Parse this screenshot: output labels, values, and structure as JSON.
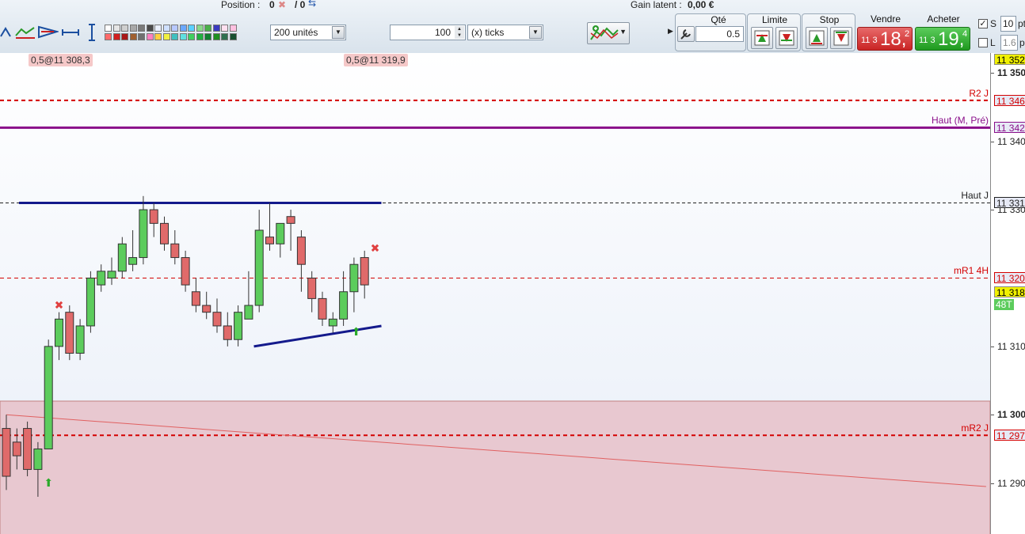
{
  "top": {
    "position_label": "Position :",
    "position_value": "0",
    "position_sep": "/ 0",
    "gain_label": "Gain latent :",
    "gain_value": "0,00 €"
  },
  "toolbar": {
    "units": "200 unités",
    "ticks_value": "100",
    "ticks_unit": "(x) ticks"
  },
  "order_panel": {
    "qte_label": "Qté",
    "qte_value": "0.5",
    "limite_label": "Limite",
    "stop_label": "Stop",
    "vendre_label": "Vendre",
    "acheter_label": "Acheter",
    "sell_price": {
      "prefix": "11 3",
      "main": "18,",
      "sup": "2"
    },
    "buy_price": {
      "prefix": "11 3",
      "main": "19,",
      "sup": "4"
    },
    "pts_value": "10",
    "pts_label": "pt",
    "s_label": "S",
    "l_label": "L",
    "l_value": "1.6",
    "l_unit": "p"
  },
  "orders": [
    {
      "label": "0,5@11 308,3"
    },
    {
      "label": "0,5@11 319,9"
    }
  ],
  "levels": [
    {
      "name": "R2 J",
      "tag": "11 346",
      "value": 11346,
      "color": "#d40000"
    },
    {
      "name": "Haut (M, Pré)",
      "tag": "11 342",
      "value": 11342,
      "color": "#8a0f8a"
    },
    {
      "name": "Haut J",
      "tag": "11 331",
      "value": 11331,
      "color": "#222222"
    },
    {
      "name": "mR1 4H",
      "tag": "11 320",
      "value": 11320,
      "color": "#d40000"
    },
    {
      "name": "mR2 J",
      "tag": "11 297",
      "value": 11297,
      "color": "#d40000"
    }
  ],
  "axis": {
    "ticks": [
      {
        "label": "11 350",
        "value": 11350,
        "bold": true
      },
      {
        "label": "11 340",
        "value": 11340,
        "bold": false
      },
      {
        "label": "11 330",
        "value": 11330,
        "bold": false
      },
      {
        "label": "11 310",
        "value": 11310,
        "bold": false
      },
      {
        "label": "11 300",
        "value": 11300,
        "bold": true
      },
      {
        "label": "11 290",
        "value": 11290,
        "bold": false
      }
    ],
    "top_tag": "11 352",
    "last_tag": "11 318",
    "timer": "48T"
  },
  "chart_data": {
    "type": "candlestick",
    "ylim": [
      11282,
      11352
    ],
    "candles": [
      {
        "o": 11298,
        "h": 11300,
        "l": 11289,
        "c": 11291
      },
      {
        "o": 11296,
        "h": 11298,
        "l": 11292,
        "c": 11294
      },
      {
        "o": 11298,
        "h": 11299,
        "l": 11291,
        "c": 11292
      },
      {
        "o": 11292,
        "h": 11296,
        "l": 11288,
        "c": 11295
      },
      {
        "o": 11295,
        "h": 11311,
        "l": 11295,
        "c": 11310
      },
      {
        "o": 11310,
        "h": 11315,
        "l": 11308,
        "c": 11314
      },
      {
        "o": 11315,
        "h": 11316,
        "l": 11308,
        "c": 11309
      },
      {
        "o": 11309,
        "h": 11314,
        "l": 11308,
        "c": 11313
      },
      {
        "o": 11313,
        "h": 11321,
        "l": 11312,
        "c": 11320
      },
      {
        "o": 11319,
        "h": 11322,
        "l": 11318,
        "c": 11321
      },
      {
        "o": 11320,
        "h": 11323,
        "l": 11319,
        "c": 11321
      },
      {
        "o": 11321,
        "h": 11326,
        "l": 11320,
        "c": 11325
      },
      {
        "o": 11322,
        "h": 11327,
        "l": 11321,
        "c": 11323
      },
      {
        "o": 11323,
        "h": 11332,
        "l": 11322,
        "c": 11330
      },
      {
        "o": 11330,
        "h": 11331,
        "l": 11326,
        "c": 11328
      },
      {
        "o": 11328,
        "h": 11329,
        "l": 11324,
        "c": 11325
      },
      {
        "o": 11325,
        "h": 11327,
        "l": 11322,
        "c": 11323
      },
      {
        "o": 11323,
        "h": 11324,
        "l": 11318,
        "c": 11319
      },
      {
        "o": 11318,
        "h": 11320,
        "l": 11315,
        "c": 11316
      },
      {
        "o": 11316,
        "h": 11318,
        "l": 11314,
        "c": 11315
      },
      {
        "o": 11315,
        "h": 11317,
        "l": 11312,
        "c": 11313
      },
      {
        "o": 11313,
        "h": 11315,
        "l": 11310,
        "c": 11311
      },
      {
        "o": 11311,
        "h": 11316,
        "l": 11310,
        "c": 11315
      },
      {
        "o": 11314,
        "h": 11321,
        "l": 11314,
        "c": 11316
      },
      {
        "o": 11316,
        "h": 11330,
        "l": 11315,
        "c": 11327
      },
      {
        "o": 11326,
        "h": 11331,
        "l": 11324,
        "c": 11325
      },
      {
        "o": 11325,
        "h": 11328,
        "l": 11323,
        "c": 11328
      },
      {
        "o": 11329,
        "h": 11330,
        "l": 11324,
        "c": 11328
      },
      {
        "o": 11326,
        "h": 11327,
        "l": 11318,
        "c": 11322
      },
      {
        "o": 11320,
        "h": 11321,
        "l": 11315,
        "c": 11317
      },
      {
        "o": 11317,
        "h": 11318,
        "l": 11313,
        "c": 11314
      },
      {
        "o": 11313,
        "h": 11315,
        "l": 11312,
        "c": 11314
      },
      {
        "o": 11314,
        "h": 11321,
        "l": 11313,
        "c": 11318
      },
      {
        "o": 11318,
        "h": 11323,
        "l": 11315,
        "c": 11322
      },
      {
        "o": 11323,
        "h": 11324,
        "l": 11317,
        "c": 11319
      }
    ],
    "trendlines": [
      {
        "from": [
          1.2,
          11331
        ],
        "to": [
          35.6,
          11331
        ],
        "color": "#141a8c"
      },
      {
        "from": [
          23.5,
          11310
        ],
        "to": [
          35.6,
          11313
        ],
        "color": "#141a8c"
      },
      {
        "from": [
          0,
          11300
        ],
        "to": [
          93.0,
          11289.5
        ],
        "color": "#e06060"
      }
    ],
    "zone": {
      "from": 11302,
      "to": 11282,
      "color": "#e8c8d0"
    }
  }
}
